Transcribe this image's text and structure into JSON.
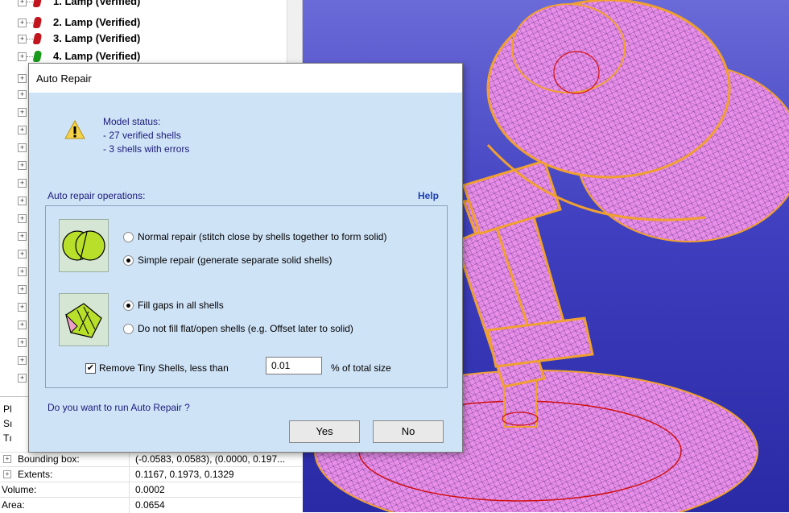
{
  "tree": {
    "items": [
      {
        "label": "1. Lamp (Verified)",
        "color": "#c2161e"
      },
      {
        "label": "2. Lamp (Verified)",
        "color": "#c2161e"
      },
      {
        "label": "3. Lamp (Verified)",
        "color": "#c2161e"
      },
      {
        "label": "4. Lamp (Verified)",
        "color": "#1a9a1a"
      }
    ]
  },
  "properties": {
    "partial_labels": [
      "Pl",
      "Sı",
      "Tı"
    ],
    "rows": [
      {
        "name": "Bounding box:",
        "value": "(-0.0583, 0.0583), (0.0000, 0.197..."
      },
      {
        "name": "Extents:",
        "value": "0.1167, 0.1973, 0.1329"
      },
      {
        "name": "Volume:",
        "value": "0.0002"
      },
      {
        "name": "Area:",
        "value": "0.0654"
      }
    ]
  },
  "dialog": {
    "title": "Auto Repair",
    "status_icon": "warning-icon",
    "status_title": "Model status:",
    "status_lines": [
      " - 27 verified shells",
      " - 3 shells with errors"
    ],
    "operations_label": "Auto repair operations:",
    "help_label": "Help",
    "repair_options": [
      {
        "label": "Normal repair (stitch close by shells together to form solid)",
        "checked": false
      },
      {
        "label": "Simple repair (generate separate solid shells)",
        "checked": true
      }
    ],
    "fill_options": [
      {
        "label": "Fill gaps in all shells",
        "checked": true
      },
      {
        "label": "Do not fill flat/open shells (e.g. Offset later to solid)",
        "checked": false
      }
    ],
    "tiny_shells": {
      "checked": true,
      "label": "Remove Tiny Shells, less than",
      "value": "0.01",
      "suffix": "% of total size"
    },
    "question": "Do you want to run Auto Repair ?",
    "yes_label": "Yes",
    "no_label": "No"
  },
  "colors": {
    "mesh": "#e98ee9",
    "mesh_edge": "#f0a030",
    "viewport_bg": "#3f3fbf",
    "dialog_bg": "#cfe3f7"
  }
}
